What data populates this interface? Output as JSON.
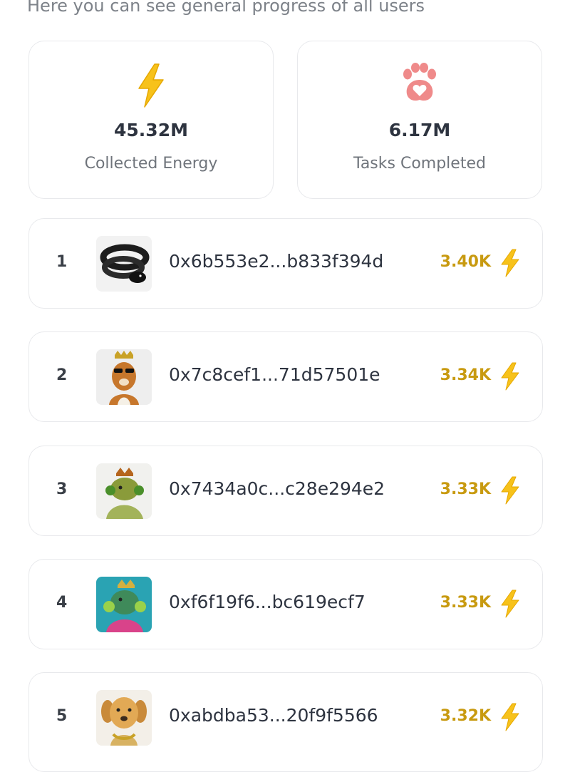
{
  "subtitle": "Here you can see general progress of all users",
  "stats": [
    {
      "value": "45.32M",
      "label": "Collected Energy",
      "icon": "lightning-icon"
    },
    {
      "value": "6.17M",
      "label": "Tasks Completed",
      "icon": "paw-heart-icon"
    }
  ],
  "leaderboard": [
    {
      "rank": "1",
      "address": "0x6b553e2...b833f394d",
      "score": "3.40K",
      "avatar": "snake-avatar"
    },
    {
      "rank": "2",
      "address": "0x7c8cef1...71d57501e",
      "score": "3.34K",
      "avatar": "dog-crown-avatar"
    },
    {
      "rank": "3",
      "address": "0x7434a0c...c28e294e2",
      "score": "3.33K",
      "avatar": "iguana-headphones-avatar"
    },
    {
      "rank": "4",
      "address": "0xf6f19f6...bc619ecf7",
      "score": "3.33K",
      "avatar": "iguana-teal-avatar"
    },
    {
      "rank": "5",
      "address": "0xabdba53...20f9f5566",
      "score": "3.32K",
      "avatar": "golden-retriever-avatar"
    }
  ],
  "colors": {
    "accent": "#f5b800",
    "score": "#c89a10",
    "paw": "#ef8a8a"
  }
}
